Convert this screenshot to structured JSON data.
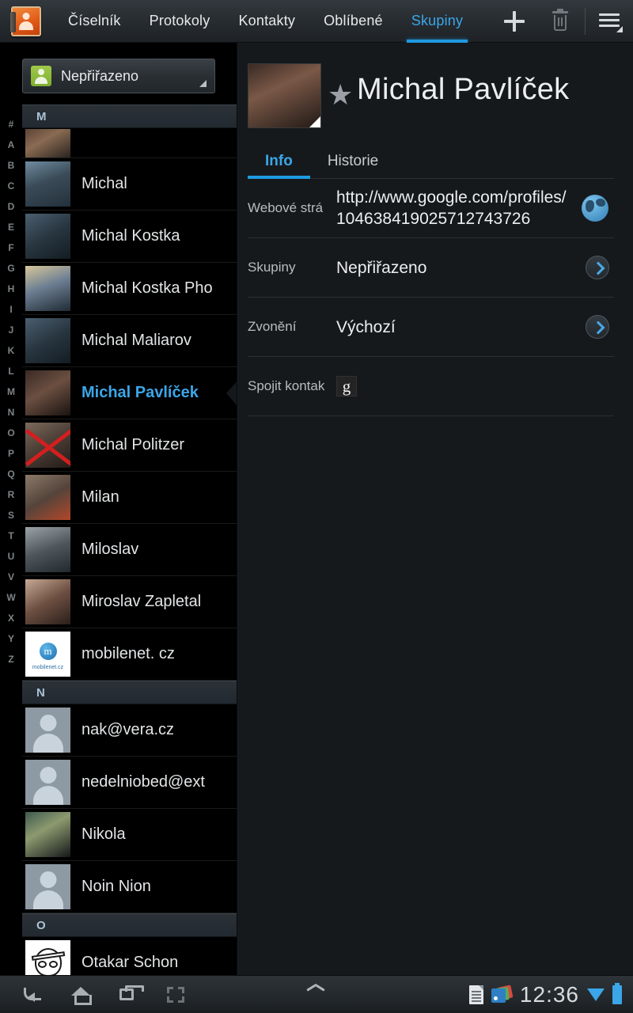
{
  "actionbar": {
    "app_icon": "contacts-book-icon",
    "tabs": [
      {
        "label": "Číselník",
        "active": false
      },
      {
        "label": "Protokoly",
        "active": false
      },
      {
        "label": "Kontakty",
        "active": false
      },
      {
        "label": "Oblíbené",
        "active": false
      },
      {
        "label": "Skupiny",
        "active": true
      }
    ],
    "add_label": "+",
    "icons": [
      "plus-icon",
      "trash-icon",
      "menu-icon"
    ],
    "accent_color": "#3ba6e8"
  },
  "sidebar": {
    "group_spinner": {
      "value": "Nepřiřazeno",
      "icon": "group-person-icon"
    },
    "index_letters": [
      "#",
      "A",
      "B",
      "C",
      "D",
      "E",
      "F",
      "G",
      "H",
      "I",
      "J",
      "K",
      "L",
      "M",
      "N",
      "O",
      "P",
      "Q",
      "R",
      "S",
      "T",
      "U",
      "V",
      "W",
      "X",
      "Y",
      "Z"
    ],
    "list": [
      {
        "type": "section",
        "label": "M"
      },
      {
        "type": "contact",
        "label": "",
        "photo": "ph1",
        "partial": true
      },
      {
        "type": "contact",
        "label": "Michal",
        "photo": "ph2"
      },
      {
        "type": "contact",
        "label": "Michal Kostka",
        "photo": "ph3"
      },
      {
        "type": "contact",
        "label": "Michal Kostka Pho",
        "photo": "ph4"
      },
      {
        "type": "contact",
        "label": "Michal Maliarov",
        "photo": "ph3"
      },
      {
        "type": "contact",
        "label": "Michal Pavlíček",
        "photo": "ph5",
        "selected": true
      },
      {
        "type": "contact",
        "label": "Michal Politzer",
        "photo": "ph6",
        "crossed": true
      },
      {
        "type": "contact",
        "label": "Milan",
        "photo": "ph7"
      },
      {
        "type": "contact",
        "label": "Miloslav",
        "photo": "ph8"
      },
      {
        "type": "contact",
        "label": "Miroslav Zapletal",
        "photo": "ph9"
      },
      {
        "type": "contact",
        "label": "mobilenet. cz",
        "photo": "ph10",
        "logo": "mobilenet.cz"
      },
      {
        "type": "section",
        "label": "N"
      },
      {
        "type": "contact",
        "label": "nak@vera.cz",
        "photo": "placeholder"
      },
      {
        "type": "contact",
        "label": "nedelniobed@ext",
        "photo": "placeholder"
      },
      {
        "type": "contact",
        "label": "Nikola",
        "photo": "ph11"
      },
      {
        "type": "contact",
        "label": "Noin Nion",
        "photo": "placeholder"
      },
      {
        "type": "section",
        "label": "O"
      },
      {
        "type": "contact",
        "label": "Otakar Schon",
        "photo": "ph12",
        "doodle": true
      }
    ]
  },
  "detail": {
    "name": "Michal Pavlíček",
    "starred_icon": "star-icon",
    "photo": "contact-photo",
    "tabs": [
      {
        "label": "Info",
        "active": true
      },
      {
        "label": "Historie",
        "active": false
      }
    ],
    "rows": [
      {
        "label": "Webové strá",
        "value": "http://www.google.com/profiles/104638419025712743726",
        "action": "globe-icon"
      },
      {
        "label": "Skupiny",
        "value": "Nepřiřazeno",
        "action": "chevron-right-icon"
      },
      {
        "label": "Zvonění",
        "value": "Výchozí",
        "action": "chevron-right-icon"
      },
      {
        "label": "Spojit kontak",
        "value": "",
        "badge": "g",
        "action": "google-badge"
      }
    ]
  },
  "systembar": {
    "nav": [
      "back-icon",
      "home-icon",
      "recents-icon",
      "screenshot-icon"
    ],
    "expand_icon": "caret-up-icon",
    "status_icons": [
      "document-icon",
      "currents-icon"
    ],
    "clock": "12:36",
    "signal_icon": "wifi-icon",
    "battery_icon": "battery-icon"
  }
}
